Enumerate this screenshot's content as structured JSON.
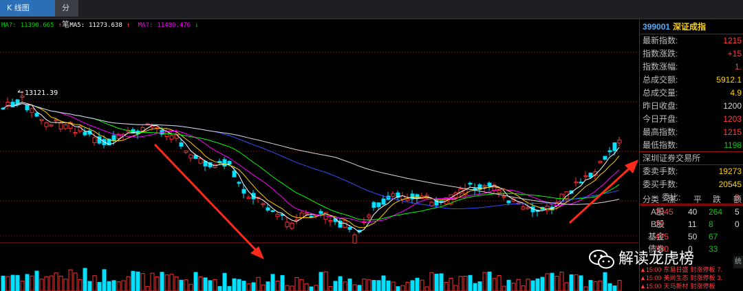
{
  "tabs": [
    {
      "label": "K 线图"
    },
    {
      "label": "分笔"
    }
  ],
  "ma_bar": {
    "ma1": {
      "label": "MA?:",
      "value": "11390.665",
      "arrow": "↑"
    },
    "ma5": {
      "label": "MA5:",
      "value": "11273.638",
      "arrow": "↑"
    },
    "ma6": {
      "label": "MA?:",
      "value": "11480.476",
      "arrow": "↓"
    }
  },
  "chart_annotations": {
    "high_label": "13121.39"
  },
  "panel": {
    "code": "399001",
    "name": "深证成指",
    "rows": [
      {
        "label": "最新指数:",
        "value": "1215",
        "color": "#ff4040"
      },
      {
        "label": "指数涨跌:",
        "value": "+15",
        "color": "#ff4040"
      },
      {
        "label": "指数涨幅:",
        "value": "1.",
        "color": "#ff4040"
      },
      {
        "label": "总成交额:",
        "value": "5912.1",
        "color": "#ffd200"
      },
      {
        "label": "总成交量:",
        "value": "4.9",
        "color": "#ffd200"
      },
      {
        "label": "昨日收盘:",
        "value": "1200",
        "color": "#d8d8d8"
      },
      {
        "label": "今日开盘:",
        "value": "1203",
        "color": "#ff4040"
      },
      {
        "label": "最高指数:",
        "value": "1215",
        "color": "#ff4040"
      },
      {
        "label": "最低指数:",
        "value": "1198",
        "color": "#00d000"
      }
    ],
    "exchange": "深圳证券交易所",
    "order_rows": [
      {
        "label": "委卖手数:",
        "value": "19273",
        "color": "#ffd200"
      },
      {
        "label": "委买手数:",
        "value": "20545",
        "color": "#ffd200"
      },
      {
        "label": "委比:",
        "value": "3.",
        "color": "#ff4040"
      }
    ],
    "breadth": {
      "headers": [
        "分类",
        "涨",
        "平",
        "跌",
        "额"
      ],
      "rows": [
        {
          "label": "A股",
          "up": "2345",
          "flat": "40",
          "down": "264",
          "extra": "5"
        },
        {
          "label": "B股",
          "up": "22",
          "flat": "11",
          "down": "8",
          "extra": "0"
        },
        {
          "label": "基金",
          "up": "475",
          "flat": "50",
          "down": "67",
          "extra": ""
        },
        {
          "label": "债券",
          "up": "330",
          "flat": "0",
          "down": "33",
          "extra": ""
        }
      ]
    },
    "feed": [
      {
        "time": "▲15:00",
        "name": "东易日盛",
        "event": "封涨停板",
        "val": "7."
      },
      {
        "time": "▲15:00",
        "name": "美尚生态",
        "event": "封涨停板",
        "val": "3."
      },
      {
        "time": "▲15:00",
        "name": "天马新材",
        "event": "封涨停板",
        "val": ""
      }
    ]
  },
  "watermark": {
    "text": "解读龙虎榜"
  },
  "colors": {
    "up": "#ff4040",
    "down": "#00d000",
    "arrow": "#ff2a1a",
    "ma5": "#ffffff",
    "ma10": "#ffd200",
    "ma20": "#ff00ff",
    "ma30": "#00ff00",
    "ma60": "#3050ff"
  }
}
